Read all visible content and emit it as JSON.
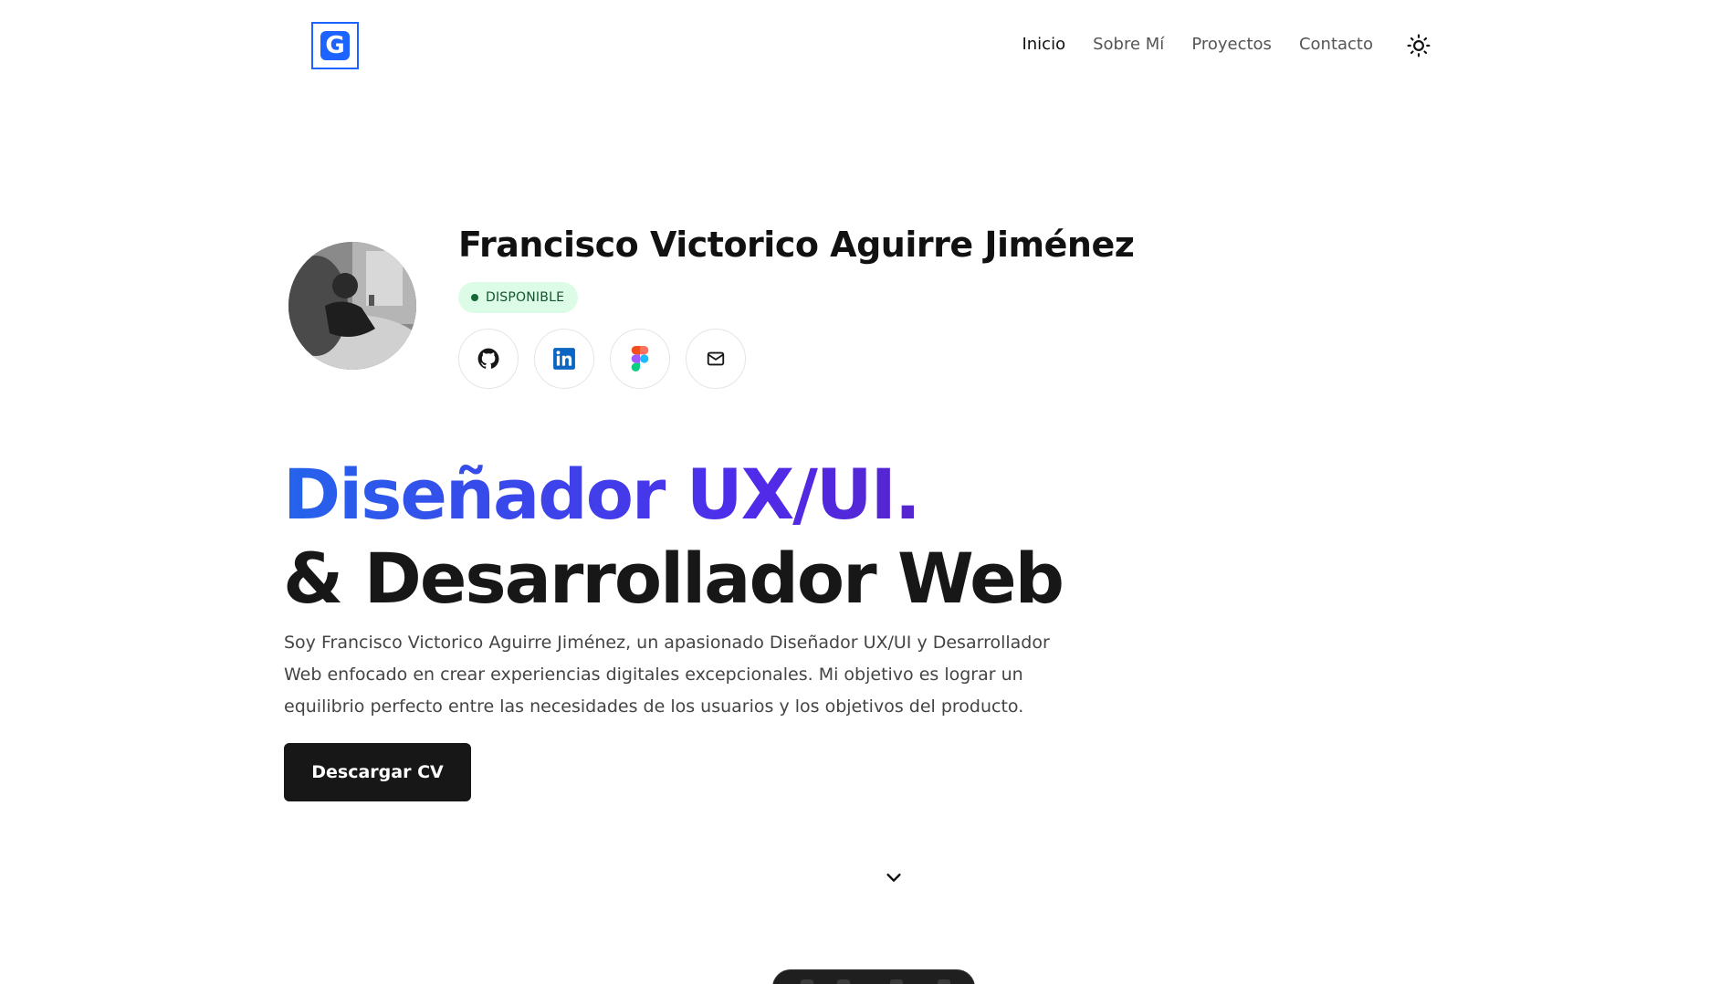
{
  "header": {
    "logo_letter": "G",
    "nav": [
      {
        "label": "Inicio",
        "active": true
      },
      {
        "label": "Sobre Mí",
        "active": false
      },
      {
        "label": "Proyectos",
        "active": false
      },
      {
        "label": "Contacto",
        "active": false
      }
    ],
    "theme_icon": "sun-icon"
  },
  "profile": {
    "name": "Francisco Victorico Aguirre Jiménez",
    "status": "DISPONIBLE",
    "socials": [
      "github-icon",
      "linkedin-icon",
      "figma-icon",
      "mail-icon"
    ]
  },
  "hero": {
    "line1": "Diseñador UX/UI.",
    "line2": "& Desarrollador Web",
    "description": "Soy Francisco Victorico Aguirre Jiménez, un apasionado Diseñador UX/UI y Desarrollador Web enfocado en crear experiencias digitales excepcionales. Mi objetivo es lograr un equilibrio perfecto entre las necesidades de los usuarios y los objetivos del producto.",
    "cta": "Descargar CV",
    "scroll_icon": "chevron-down-icon"
  },
  "colors": {
    "accent_blue": "#2563eb",
    "accent_purple": "#5b21b6",
    "badge_bg": "#dcfce7",
    "button_bg": "#171717"
  }
}
